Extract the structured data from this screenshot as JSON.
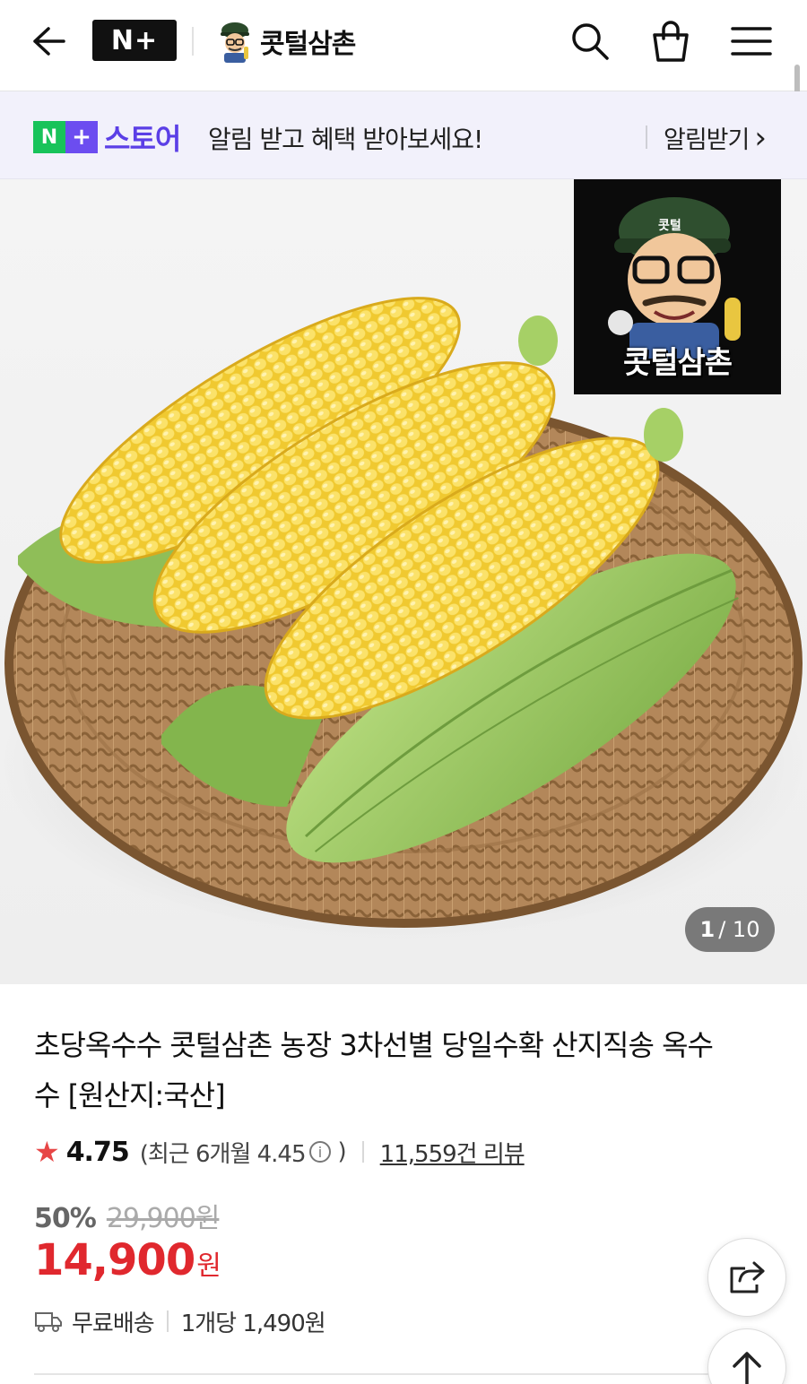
{
  "header": {
    "badge_label": "N+",
    "store_name": "콧털삼촌",
    "icons": [
      "back-arrow-icon",
      "search-icon",
      "shopping-bag-icon",
      "hamburger-menu-icon"
    ]
  },
  "banner": {
    "nplus_n": "N",
    "nplus_plus": "+",
    "store_word": "스토어",
    "message": "알림 받고 혜택 받아보세요!",
    "action_label": "알림받기",
    "chevron": "›"
  },
  "gallery": {
    "seller_badge_name": "콧털삼촌",
    "seller_cap_text": "콧털",
    "current": "1",
    "total": "/ 10"
  },
  "product": {
    "title": "초당옥수수 콧털삼촌 농장 3차선별 당일수확 산지직송 옥수수 [원산지:국산]",
    "rating": {
      "star": "★",
      "score": "4.75",
      "recent_prefix": "(최근 6개월 4.45",
      "info_icon": "i",
      "recent_suffix": ")",
      "reviews": "11,559건 리뷰"
    },
    "discount_percent": "50%",
    "original_price": "29,900원",
    "price": "14,900",
    "price_unit": "원",
    "shipping": "무료배송",
    "per_unit": "1개당 1,490원"
  },
  "colors": {
    "accent_red": "#e0282e",
    "naver_green": "#18c35a",
    "store_purple": "#5b3fe6",
    "banner_bg": "#f2f1fb"
  }
}
